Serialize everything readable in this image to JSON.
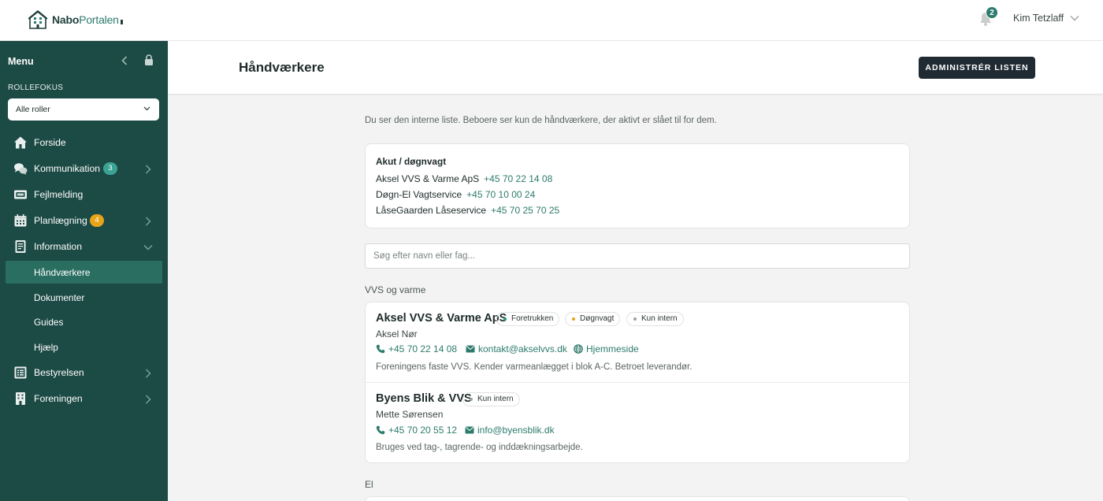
{
  "app": {
    "logo_nabo": "Nabo",
    "logo_portal": "Portalen"
  },
  "header": {
    "notification_count": "2",
    "user_name": "Kim Tetzlaff"
  },
  "sidebar": {
    "menu_title": "Menu",
    "role_focus_label": "ROLLEFOKUS",
    "role_select_value": "Alle roller",
    "items": [
      {
        "label": "Forside",
        "icon": "home-icon"
      },
      {
        "label": "Kommunikation",
        "icon": "chat-icon",
        "badge": "3"
      },
      {
        "label": "Fejlmelding",
        "icon": "report-icon"
      },
      {
        "label": "Planlægning",
        "icon": "calendar-icon",
        "badge": "4"
      },
      {
        "label": "Information",
        "icon": "document-icon"
      },
      {
        "label": "Bestyrelsen",
        "icon": "board-icon"
      },
      {
        "label": "Foreningen",
        "icon": "building-icon"
      }
    ],
    "subitems": [
      "Håndværkere",
      "Dokumenter",
      "Guides",
      "Hjælp"
    ]
  },
  "page": {
    "title": "Håndværkere",
    "admin_button": "ADMINISTRÉR LISTEN"
  },
  "intro": "Du ser den interne liste. Beboere ser kun de håndværkere, der aktivt er slået til for dem.",
  "akut": {
    "title": "Akut / døgnvagt",
    "rows": [
      {
        "name": "Aksel VVS & Varme ApS",
        "phone": "+45 70 22 14 08"
      },
      {
        "name": "Døgn-El Vagtservice",
        "phone": "+45 70 10 00 24"
      },
      {
        "name": "LåseGaarden Låseservice",
        "phone": "+45 70 25 70 25"
      }
    ]
  },
  "search": {
    "placeholder": "Søg efter navn eller fag..."
  },
  "sections": [
    {
      "label": "VVS og varme",
      "entries": [
        {
          "name": "Aksel VVS & Varme ApS",
          "chips": [
            {
              "label": "Foretrukken",
              "color": "#2d9b7c"
            },
            {
              "label": "Døgnvagt",
              "color": "#e8a419"
            },
            {
              "label": "Kun intern",
              "color": "#9aa2a1"
            }
          ],
          "person": "Aksel Nør",
          "phone": "+45 70 22 14 08",
          "email": "kontakt@akselvvs.dk",
          "website": "Hjemmeside",
          "description": "Foreningens faste VVS. Kender varmeanlægget i blok A-C. Betroet leverandør."
        },
        {
          "name": "Byens Blik & VVS",
          "chips": [
            {
              "label": "Kun intern",
              "color": "#9aa2a1"
            }
          ],
          "person": "Mette Sørensen",
          "phone": "+45 70 20 55 12",
          "email": "info@byensblik.dk",
          "description": "Bruges ved tag-, tagrende- og inddækningsarbejde."
        }
      ]
    },
    {
      "label": "El"
    }
  ],
  "colors": {
    "sidebar": "#1c4a45",
    "accent": "#2d7b6c",
    "active": "#2a6e62",
    "button": "#1f2a33"
  }
}
